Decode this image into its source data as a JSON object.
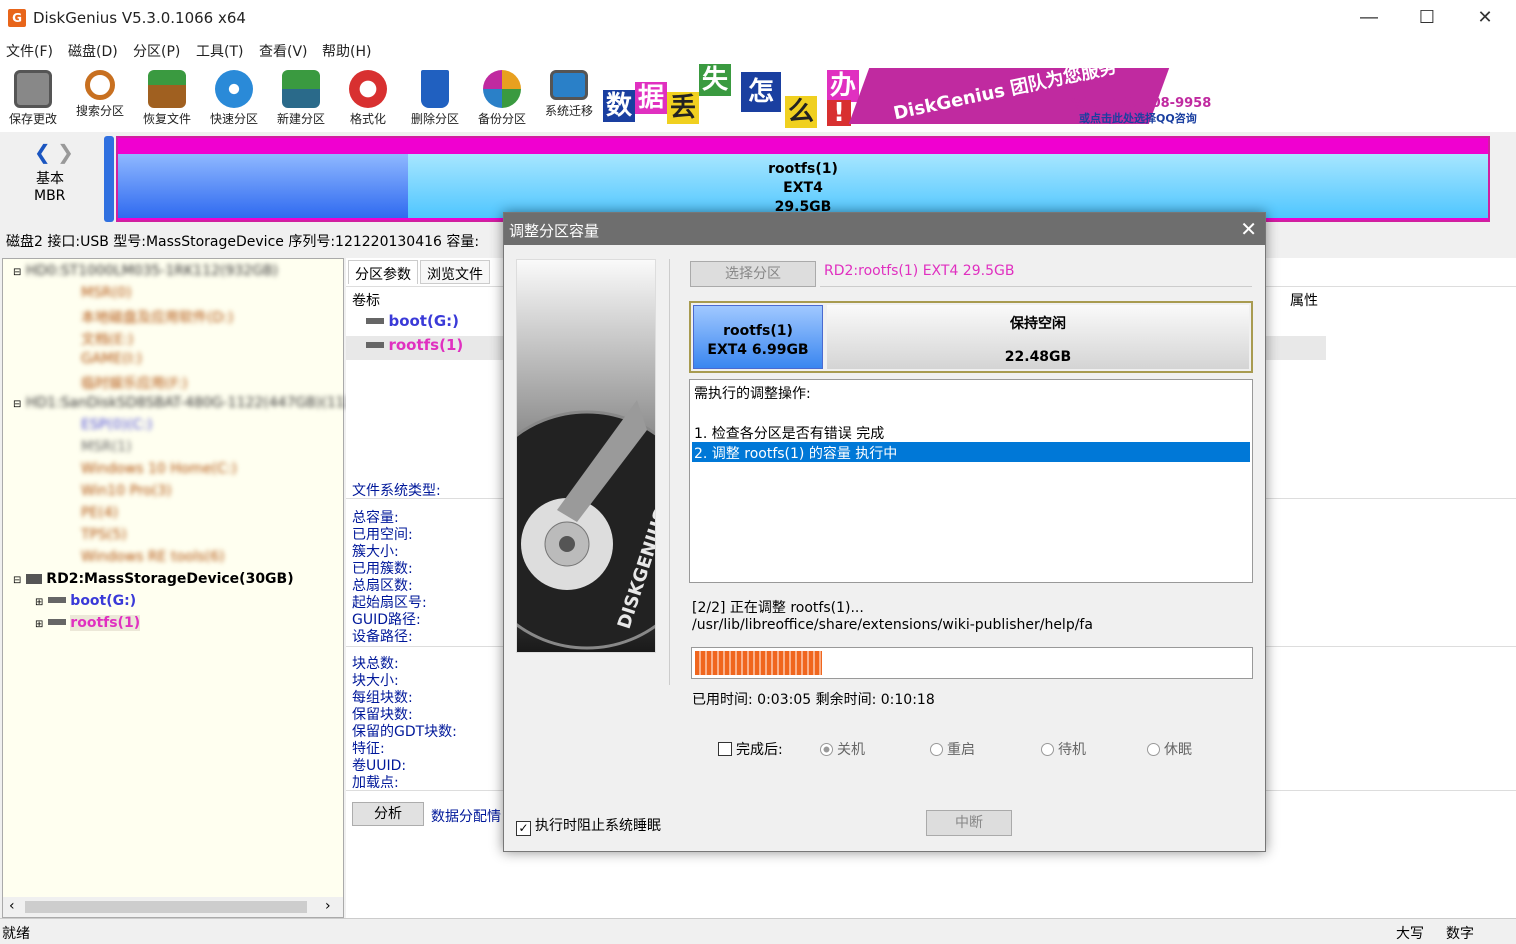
{
  "window": {
    "title": "DiskGenius V5.3.0.1066 x64",
    "app_icon": "G"
  },
  "menu": [
    "文件(F)",
    "磁盘(D)",
    "分区(P)",
    "工具(T)",
    "查看(V)",
    "帮助(H)"
  ],
  "toolbar": [
    {
      "label": "保存更改",
      "icon": "save-icon",
      "color": "#888888"
    },
    {
      "label": "搜索分区",
      "icon": "magnifier-icon",
      "color": "#c87020"
    },
    {
      "label": "恢复文件",
      "icon": "restore-icon",
      "color": "#a06020"
    },
    {
      "label": "快速分区",
      "icon": "disc-icon",
      "color": "#2a8ad8"
    },
    {
      "label": "新建分区",
      "icon": "layers-icon",
      "color": "#3a9a40"
    },
    {
      "label": "格式化",
      "icon": "lifebuoy-icon",
      "color": "#d83030"
    },
    {
      "label": "删除分区",
      "icon": "trash-icon",
      "color": "#2060c0"
    },
    {
      "label": "备份分区",
      "icon": "pie-icon",
      "color": "#e8a020"
    },
    {
      "label": "系统迁移",
      "icon": "monitor-icon",
      "color": "#2a80c8"
    }
  ],
  "banner": {
    "chars": [
      "数",
      "据",
      "丢",
      "失",
      "怎",
      "么",
      "办",
      "!"
    ],
    "team": "DiskGenius 团队为您服务",
    "phone": "致电：400-008-9958",
    "qq": "或点击此处选择QQ咨询"
  },
  "disk_map": {
    "type1": "基本",
    "type2": "MBR",
    "part_name": "rootfs(1)",
    "part_fs": "EXT4",
    "part_size": "29.5GB"
  },
  "disk_info": "磁盘2 接口:USB  型号:MassStorageDevice  序列号:121220130416  容量:",
  "tree": {
    "disk0": "HD0:ST1000LM035-1RK112(932GB)",
    "disk0_parts": [
      "MSR(0)",
      "本地磁盘及应用软件(D:)",
      "文档(E:)",
      "GAME(I:)",
      "临时娱乐应用(F:)"
    ],
    "disk1": "HD1:SanDiskSD8SBAT-480G-1122(447GB)(11)",
    "disk1_parts": [
      "ESP(0)(C:)",
      "MSR(1)",
      "Windows 10 Home(C:)",
      "Win10 Pro(3)",
      "PE(4)",
      "TPS(5)",
      "Windows RE tools(6)"
    ],
    "disk2": "RD2:MassStorageDevice(30GB)",
    "disk2_parts": [
      {
        "label": "boot(G:)",
        "color": "#3a3ad8"
      },
      {
        "label": "rootfs(1)",
        "color": "#e030c0"
      }
    ]
  },
  "right": {
    "tabs": [
      "分区参数",
      "浏览文件"
    ],
    "col_volume": "卷标",
    "col_attr": "属性",
    "rows": [
      {
        "label": "boot(G:)",
        "color": "#3a3ad8"
      },
      {
        "label": "rootfs(1)",
        "color": "#e030c0"
      }
    ],
    "fs_type_label": "文件系统类型:",
    "fields1": [
      "总容量:",
      "已用空间:",
      "簇大小:",
      "已用簇数:",
      "总扇区数:",
      "起始扇区号:",
      "GUID路径:",
      "设备路径:"
    ],
    "fields2": [
      "块总数:",
      "块大小:",
      "每组块数:",
      "保留块数:",
      "保留的GDT块数:",
      "特征:",
      "卷UUID:",
      "加载点:"
    ],
    "analyze_btn": "分析",
    "alloc_label": "数据分配情"
  },
  "status": {
    "left": "就绪",
    "caps": "大写",
    "num": "数字"
  },
  "dialog": {
    "title": "调整分区容量",
    "select_btn": "选择分区",
    "selected": "RD2:rootfs(1) EXT4 29.5GB",
    "part_name": "rootfs(1)",
    "part_info": "EXT4 6.99GB",
    "free_label": "保持空闲",
    "free_size": "22.48GB",
    "ops_header": "需执行的调整操作:",
    "ops": [
      "1. 检查各分区是否有错误    完成",
      "2. 调整 rootfs(1) 的容量    执行中"
    ],
    "progress_line1": "[2/2] 正在调整 rootfs(1)...",
    "progress_line2": "/usr/lib/libreoffice/share/extensions/wiki-publisher/help/fa",
    "progress": 0.23,
    "times": "已用时间:  0:03:05   剩余时间:  0:10:18",
    "after_label": "完成后:",
    "radios": [
      "关机",
      "重启",
      "待机",
      "休眠"
    ],
    "prevent_sleep": "执行时阻止系统睡眠",
    "stop_btn": "中断",
    "art_text": "DISKGENIUS"
  }
}
